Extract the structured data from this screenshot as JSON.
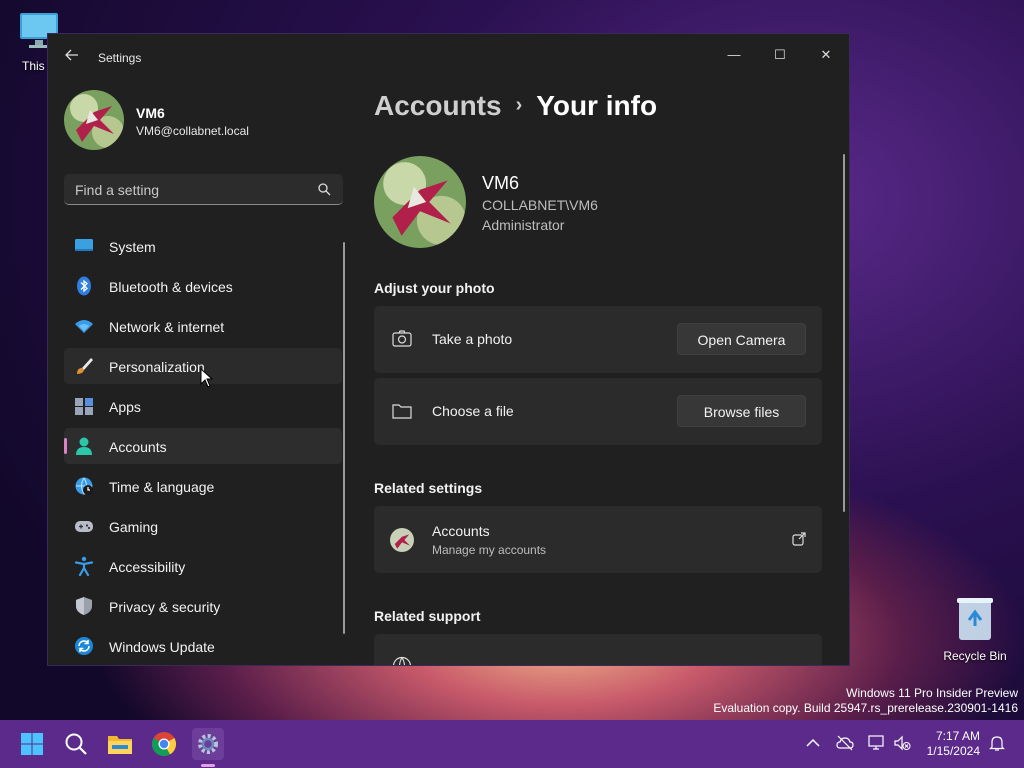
{
  "desktop": {
    "this_pc_label": "This P",
    "recycle_bin_label": "Recycle Bin",
    "watermark_line1": "Windows 11 Pro Insider Preview",
    "watermark_line2": "Evaluation copy. Build 25947.rs_prerelease.230901-1416"
  },
  "window": {
    "title": "Settings",
    "controls": {
      "minimize": "—",
      "maximize": "☐",
      "close": "✕"
    }
  },
  "sidebar": {
    "user_name": "VM6",
    "user_email": "VM6@collabnet.local",
    "search_placeholder": "Find a setting",
    "items": [
      {
        "label": "System",
        "icon": "system-icon"
      },
      {
        "label": "Bluetooth & devices",
        "icon": "bluetooth-icon"
      },
      {
        "label": "Network & internet",
        "icon": "network-icon"
      },
      {
        "label": "Personalization",
        "icon": "brush-icon"
      },
      {
        "label": "Apps",
        "icon": "apps-icon"
      },
      {
        "label": "Accounts",
        "icon": "accounts-icon"
      },
      {
        "label": "Time & language",
        "icon": "globe-clock-icon"
      },
      {
        "label": "Gaming",
        "icon": "gamepad-icon"
      },
      {
        "label": "Accessibility",
        "icon": "accessibility-icon"
      },
      {
        "label": "Privacy & security",
        "icon": "shield-icon"
      },
      {
        "label": "Windows Update",
        "icon": "update-icon"
      }
    ],
    "selected": "Accounts",
    "hovered": "Personalization"
  },
  "breadcrumb": {
    "parent": "Accounts",
    "separator": "›",
    "current": "Your info"
  },
  "user": {
    "name": "VM6",
    "domain": "COLLABNET\\VM6",
    "role": "Administrator"
  },
  "adjust_photo": {
    "heading": "Adjust your photo",
    "take_photo_label": "Take a photo",
    "open_camera_button": "Open Camera",
    "choose_file_label": "Choose a file",
    "browse_files_button": "Browse files"
  },
  "related_settings": {
    "heading": "Related settings",
    "accounts_title": "Accounts",
    "accounts_subtitle": "Manage my accounts"
  },
  "related_support": {
    "heading": "Related support"
  },
  "taskbar": {
    "time": "7:17 AM",
    "date": "1/15/2024",
    "apps": [
      "start-icon",
      "search-icon",
      "file-explorer-icon",
      "chrome-icon",
      "settings-icon"
    ]
  },
  "colors": {
    "accent": "#d882c8",
    "taskbar": "#5b2a8a",
    "window_bg": "#202020",
    "card_bg": "#2b2b2b"
  }
}
